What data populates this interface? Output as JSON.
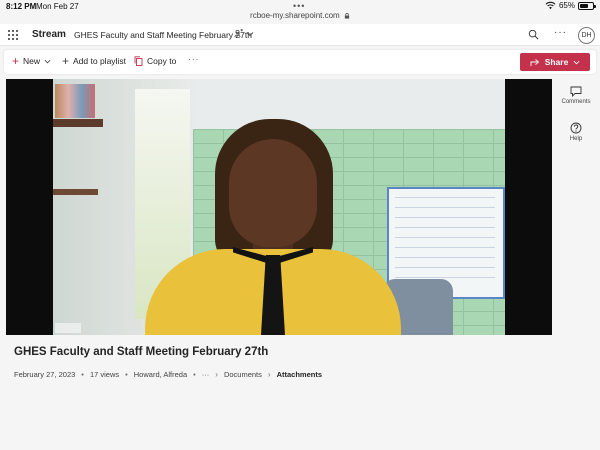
{
  "status_bar": {
    "time": "8:12 PM",
    "date": "Mon Feb 27",
    "battery": "65%",
    "battery_level": 0.65
  },
  "browser": {
    "url": "rcboe-my.sharepoint.com"
  },
  "header": {
    "app_name": "Stream",
    "document_title": "GHES Faculty and Staff Meeting February 27th",
    "avatar_initials": "DH",
    "icons": [
      "waffle-icon",
      "share-people-icon",
      "chevron-down-icon",
      "search-icon",
      "more-icon"
    ]
  },
  "toolbar": {
    "new_label": "New",
    "add_playlist_label": "Add to playlist",
    "copy_to_label": "Copy to",
    "more_label": "···",
    "share_label": "Share"
  },
  "rail": {
    "comments_label": "Comments",
    "help_label": "Help"
  },
  "video": {
    "title": "GHES Faculty and Staff Meeting February 27th",
    "date": "February 27, 2023",
    "views": "17 views",
    "owner": "Howard, Alfreda",
    "more": "···",
    "breadcrumb": [
      "Documents",
      "Attachments"
    ]
  },
  "colors": {
    "accent": "#c4314b",
    "background": "#f5f5f5",
    "player_bg": "#0c0c0c"
  }
}
